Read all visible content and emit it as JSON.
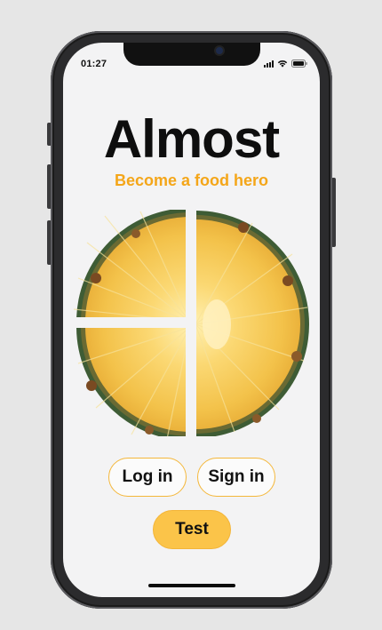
{
  "status_bar": {
    "time": "01:27",
    "icons": [
      "cellular-signal-icon",
      "wifi-icon",
      "battery-icon"
    ]
  },
  "app": {
    "title": "Almost",
    "tagline": "Become a food hero",
    "hero_image": "pineapple-slice-quartered"
  },
  "actions": {
    "login_label": "Log in",
    "signin_label": "Sign in",
    "test_label": "Test"
  },
  "colors": {
    "background": "#e6e6e6",
    "screen": "#f3f3f4",
    "accent": "#f4a619",
    "button_outline": "#f4b73a",
    "button_fill": "#fbc449",
    "text": "#111111"
  }
}
